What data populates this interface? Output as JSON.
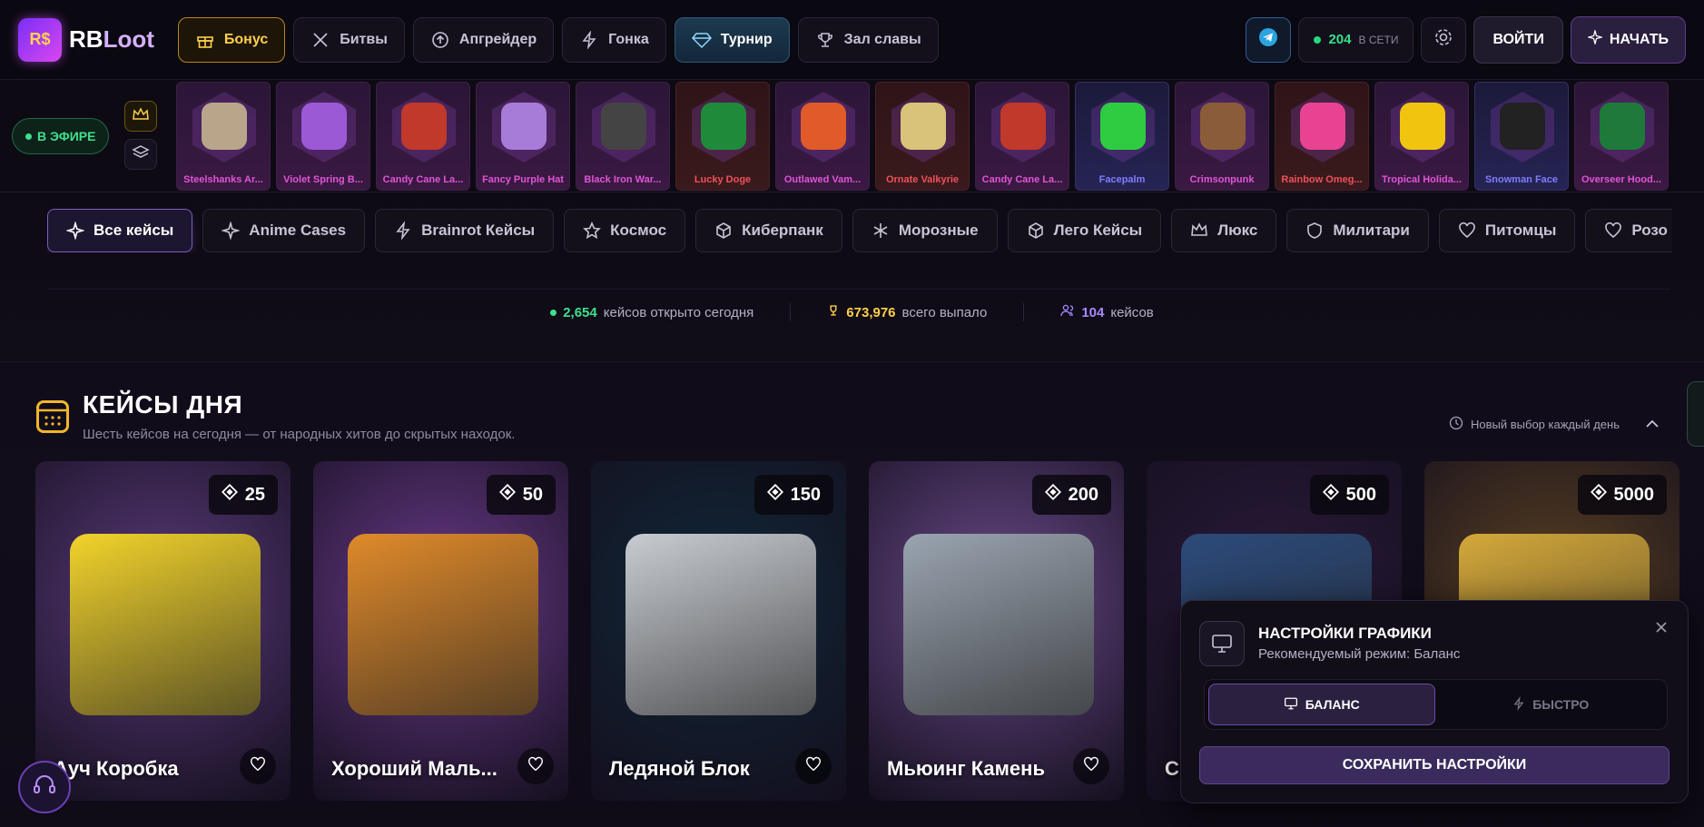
{
  "header": {
    "logo_badge": "R$",
    "logo_text_a": "RB",
    "logo_text_b": "Loot",
    "nav": [
      {
        "label": "Бонус",
        "icon": "gift-icon"
      },
      {
        "label": "Битвы",
        "icon": "swords-icon"
      },
      {
        "label": "Апгрейдер",
        "icon": "arrow-up-circle-icon"
      },
      {
        "label": "Гонка",
        "icon": "lightning-icon"
      },
      {
        "label": "Турнир",
        "icon": "diamond-icon"
      },
      {
        "label": "Зал славы",
        "icon": "trophy-icon"
      }
    ],
    "online_count": "204",
    "online_label": "В СЕТИ",
    "login_label": "ВОЙТИ",
    "start_label": "НАЧАТЬ"
  },
  "live": {
    "badge": "В ЭФИРЕ",
    "drops": [
      {
        "name": "Steelshanks Ar...",
        "rarity": "purple",
        "color": "#b9a58a"
      },
      {
        "name": "Violet Spring B...",
        "rarity": "purple",
        "color": "#9b59d6"
      },
      {
        "name": "Candy Cane La...",
        "rarity": "purple",
        "color": "#c0392b"
      },
      {
        "name": "Fancy Purple Hat",
        "rarity": "purple",
        "color": "#a77bd8"
      },
      {
        "name": "Black Iron War...",
        "rarity": "purple",
        "color": "#444"
      },
      {
        "name": "Lucky Doge",
        "rarity": "red",
        "color": "#1f8a3a"
      },
      {
        "name": "Outlawed Vam...",
        "rarity": "purple",
        "color": "#e05a2a"
      },
      {
        "name": "Ornate Valkyrie",
        "rarity": "red",
        "color": "#d9c27a"
      },
      {
        "name": "Candy Cane La...",
        "rarity": "purple",
        "color": "#c0392b"
      },
      {
        "name": "Facepalm",
        "rarity": "blue",
        "color": "#2ecc40"
      },
      {
        "name": "Crimsonpunk",
        "rarity": "purple",
        "color": "#8a5c3a"
      },
      {
        "name": "Rainbow Omeg...",
        "rarity": "red",
        "color": "#e84393"
      },
      {
        "name": "Tropical Holida...",
        "rarity": "purple",
        "color": "#f1c40f"
      },
      {
        "name": "Snowman Face",
        "rarity": "blue",
        "color": "#222"
      },
      {
        "name": "Overseer Hood...",
        "rarity": "purple",
        "color": "#1d7a3a"
      }
    ]
  },
  "categories": [
    {
      "label": "Все кейсы",
      "icon": "sparkles-icon",
      "active": true
    },
    {
      "label": "Anime Cases",
      "icon": "sparkles-icon"
    },
    {
      "label": "Brainrot Кейсы",
      "icon": "lightning-icon"
    },
    {
      "label": "Космос",
      "icon": "star-icon"
    },
    {
      "label": "Киберпанк",
      "icon": "cube-icon"
    },
    {
      "label": "Морозные",
      "icon": "snowflake-icon"
    },
    {
      "label": "Лего Кейсы",
      "icon": "cube-icon"
    },
    {
      "label": "Люкс",
      "icon": "crown-icon"
    },
    {
      "label": "Милитари",
      "icon": "shield-icon"
    },
    {
      "label": "Питомцы",
      "icon": "heart-icon"
    },
    {
      "label": "Розо",
      "icon": "heart-icon"
    }
  ],
  "stats": {
    "opened_value": "2,654",
    "opened_label": "кейсов открыто сегодня",
    "dropped_value": "673,976",
    "dropped_label": "всего выпало",
    "cases_value": "104",
    "cases_label": "кейсов"
  },
  "section": {
    "title": "КЕЙСЫ ДНЯ",
    "subtitle": "Шесть кейсов на сегодня — от народных хитов до скрытых находок.",
    "right_label": "Новый выбор каждый день"
  },
  "cases": [
    {
      "name": "Ауч Коробка",
      "price": "25",
      "bg": "#5a3a7a",
      "box": "#f2d32b"
    },
    {
      "name": "Хороший Маль...",
      "price": "50",
      "bg": "#6a3a8a",
      "box": "#e08a2a"
    },
    {
      "name": "Ледяной Блок",
      "price": "150",
      "bg": "#102838",
      "box": "#c8ccd2"
    },
    {
      "name": "Мьюинг Камень",
      "price": "200",
      "bg": "#6a4a8a",
      "box": "#9aa4b0"
    },
    {
      "name": "Сі",
      "price": "500",
      "bg": "#2a1a3a",
      "box": "#2c4a7a"
    },
    {
      "name": "",
      "price": "5000",
      "bg": "#5a4020",
      "box": "#d4a83a"
    }
  ],
  "graphics": {
    "title": "НАСТРОЙКИ ГРАФИКИ",
    "subtitle": "Рекомендуемый режим: Баланс",
    "mode_balance": "БАЛАНС",
    "mode_fast": "БЫСТРО",
    "save_label": "СОХРАНИТЬ НАСТРОЙКИ"
  }
}
